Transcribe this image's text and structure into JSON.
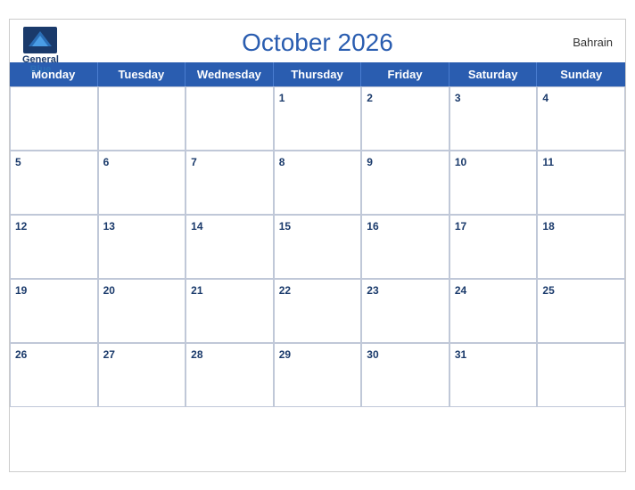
{
  "header": {
    "title": "October 2026",
    "country": "Bahrain",
    "logo": {
      "line1": "General",
      "line2": "Blue"
    }
  },
  "days": [
    "Monday",
    "Tuesday",
    "Wednesday",
    "Thursday",
    "Friday",
    "Saturday",
    "Sunday"
  ],
  "weeks": [
    [
      null,
      null,
      null,
      1,
      2,
      3,
      4
    ],
    [
      5,
      6,
      7,
      8,
      9,
      10,
      11
    ],
    [
      12,
      13,
      14,
      15,
      16,
      17,
      18
    ],
    [
      19,
      20,
      21,
      22,
      23,
      24,
      25
    ],
    [
      26,
      27,
      28,
      29,
      30,
      31,
      null
    ]
  ]
}
